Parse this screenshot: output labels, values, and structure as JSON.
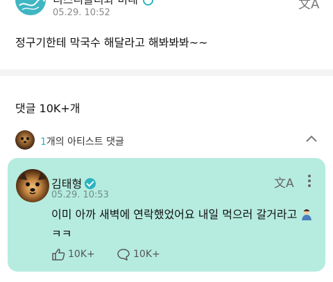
{
  "post": {
    "author": "디즈니플리와 미네",
    "timestamp": "05.29. 10:52",
    "text": "정구기한테 막국수 해달라고 해봐봐봐~~"
  },
  "comments": {
    "count_label": "댓글 10K+개",
    "artist_count": "1",
    "artist_label": "개의 아티스트 댓글"
  },
  "artist_comment": {
    "name": "김태형",
    "timestamp": "05.29. 10:53",
    "text": "이미 아까 새벽에 연락했었어요 내일 먹으러 갈거라고",
    "suffix": "ㅋㅋ",
    "likes": "10K+",
    "replies": "10K+"
  },
  "icons": {
    "translate": "translate-icon",
    "more": "more-vertical-icon",
    "chevron": "chevron-up-icon",
    "like": "like-icon",
    "reply": "reply-icon",
    "verified": "verified-icon"
  },
  "colors": {
    "accent": "#2bb3c0",
    "card_bg": "#b6ecdf"
  }
}
